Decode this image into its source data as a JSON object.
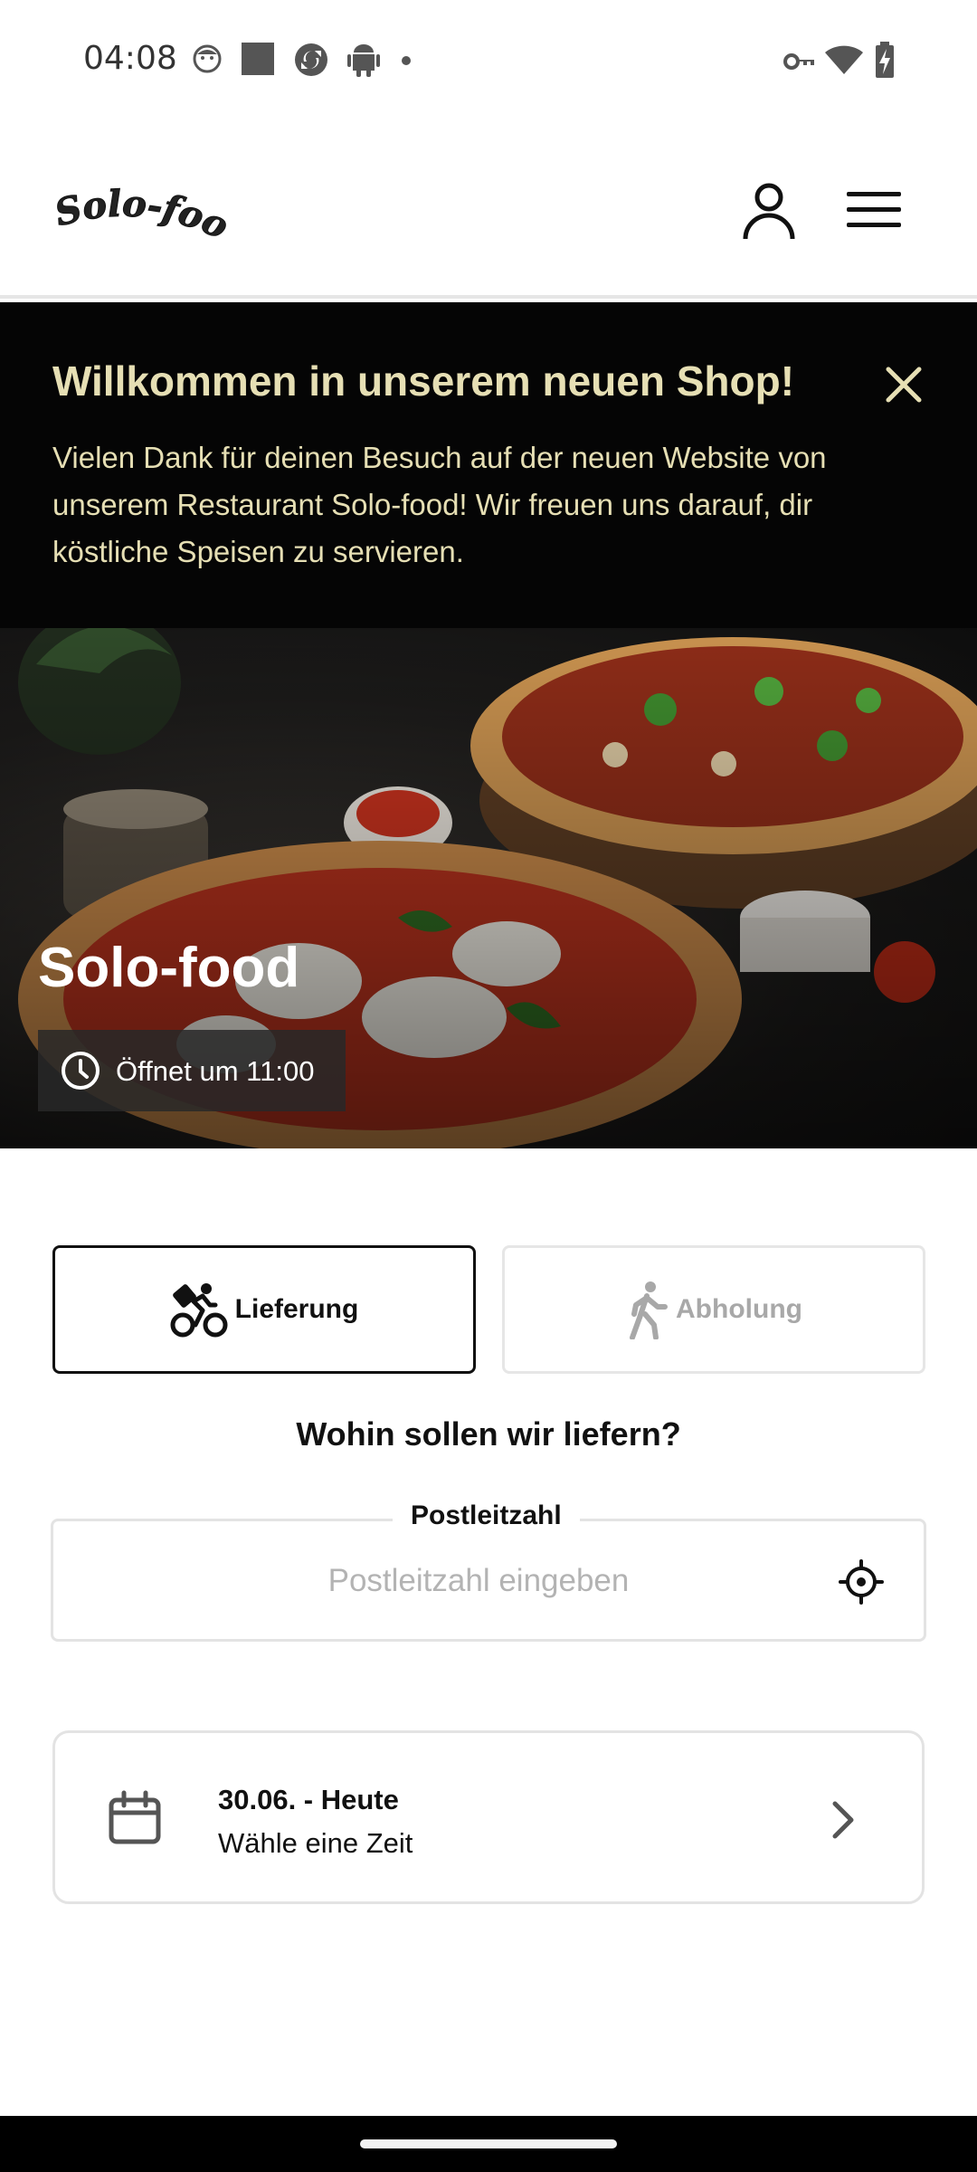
{
  "status_bar": {
    "time": "04:08",
    "left_icons": [
      "face-icon",
      "square-icon",
      "sync-icon",
      "android-icon",
      "dot-icon"
    ],
    "right_icons": [
      "key-icon",
      "wifi-icon",
      "battery-charging-icon"
    ]
  },
  "header": {
    "logo_text": "Solo-food",
    "account_icon": "person-icon",
    "menu_icon": "hamburger-icon"
  },
  "banner": {
    "title": "Willkommen in unserem neuen Shop!",
    "text": "Vielen Dank für deinen Besuch auf der neuen Website von unserem Restaurant Solo-food! Wir freuen uns darauf, dir köstliche Speisen zu servieren.",
    "close_icon": "close-icon",
    "color": "#e6dfb4"
  },
  "hero": {
    "title": "Solo-food",
    "opening_text": "Öffnet um 11:00",
    "clock_icon": "clock-icon"
  },
  "order_mode": {
    "delivery_label": "Lieferung",
    "pickup_label": "Abholung",
    "selected": "delivery",
    "delivery_icon": "bicycle-courier-icon",
    "pickup_icon": "walking-person-icon"
  },
  "delivery_question": "Wohin sollen wir liefern?",
  "zip": {
    "label": "Postleitzahl",
    "placeholder": "Postleitzahl eingeben",
    "value": "",
    "locate_icon": "crosshair-icon"
  },
  "time_card": {
    "date_label": "30.06. - Heute",
    "hint": "Wähle eine Zeit",
    "calendar_icon": "calendar-icon",
    "chevron_icon": "chevron-right-icon"
  }
}
